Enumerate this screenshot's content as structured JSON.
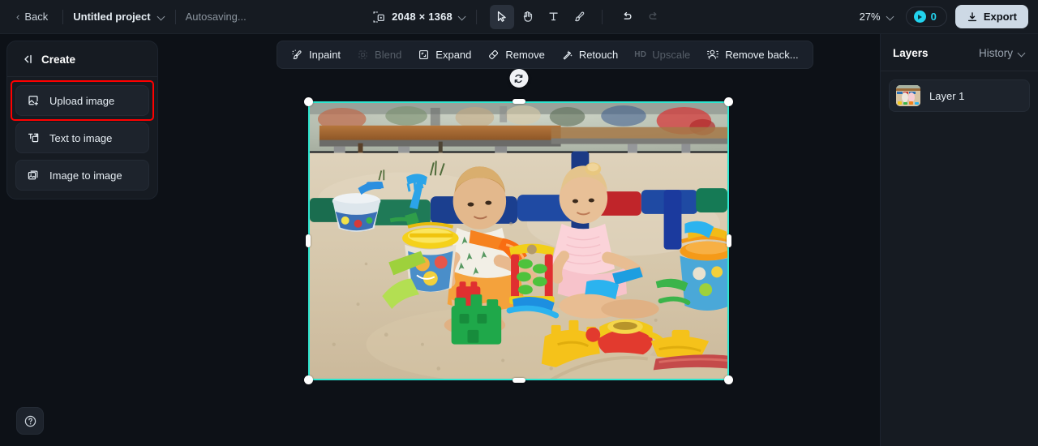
{
  "topbar": {
    "back_label": "Back",
    "project_name": "Untitled project",
    "autosave_status": "Autosaving...",
    "canvas_size": "2048 × 1368",
    "tools": [
      {
        "name": "select-tool",
        "icon": "cursor-icon",
        "active": true
      },
      {
        "name": "pan-tool",
        "icon": "hand-icon",
        "active": false
      },
      {
        "name": "text-tool",
        "icon": "text-icon",
        "active": false
      },
      {
        "name": "brush-tool",
        "icon": "brush-icon",
        "active": false
      }
    ],
    "undo_label": "undo-icon",
    "redo_label": "redo-icon",
    "zoom_level": "27%",
    "credits": "0",
    "export_label": "Export"
  },
  "sidebar": {
    "title": "Create",
    "collapse_icon": "collapse-left-icon",
    "items": [
      {
        "label": "Upload image",
        "icon": "upload-image-icon",
        "highlighted": true
      },
      {
        "label": "Text to image",
        "icon": "text-to-image-icon",
        "highlighted": false
      },
      {
        "label": "Image to image",
        "icon": "image-to-image-icon",
        "highlighted": false
      }
    ],
    "help_label": "help-icon"
  },
  "canvas_toolbar": {
    "items": [
      {
        "label": "Inpaint",
        "icon": "inpaint-icon",
        "disabled": false
      },
      {
        "label": "Blend",
        "icon": "blend-icon",
        "disabled": true
      },
      {
        "label": "Expand",
        "icon": "expand-icon",
        "disabled": false
      },
      {
        "label": "Remove",
        "icon": "remove-icon",
        "disabled": false
      },
      {
        "label": "Retouch",
        "icon": "retouch-icon",
        "disabled": false
      },
      {
        "label": "Upscale",
        "icon": "upscale-icon",
        "badge": "HD",
        "disabled": true
      },
      {
        "label": "Remove back...",
        "icon": "remove-background-icon",
        "disabled": false
      }
    ]
  },
  "canvas": {
    "selection_color": "#2ee6d0",
    "rotate_label": "rotate-icon",
    "image_description": "Two toddlers playing with colorful plastic toys in a playground sandbox"
  },
  "right_panel": {
    "layers_tab": "Layers",
    "history_tab": "History",
    "layers": [
      {
        "name": "Layer 1"
      }
    ]
  },
  "colors": {
    "accent": "#22d3ee",
    "selection": "#2ee6d0",
    "highlight": "#ff0000",
    "background": "#0d1117",
    "panel": "#161b22"
  }
}
